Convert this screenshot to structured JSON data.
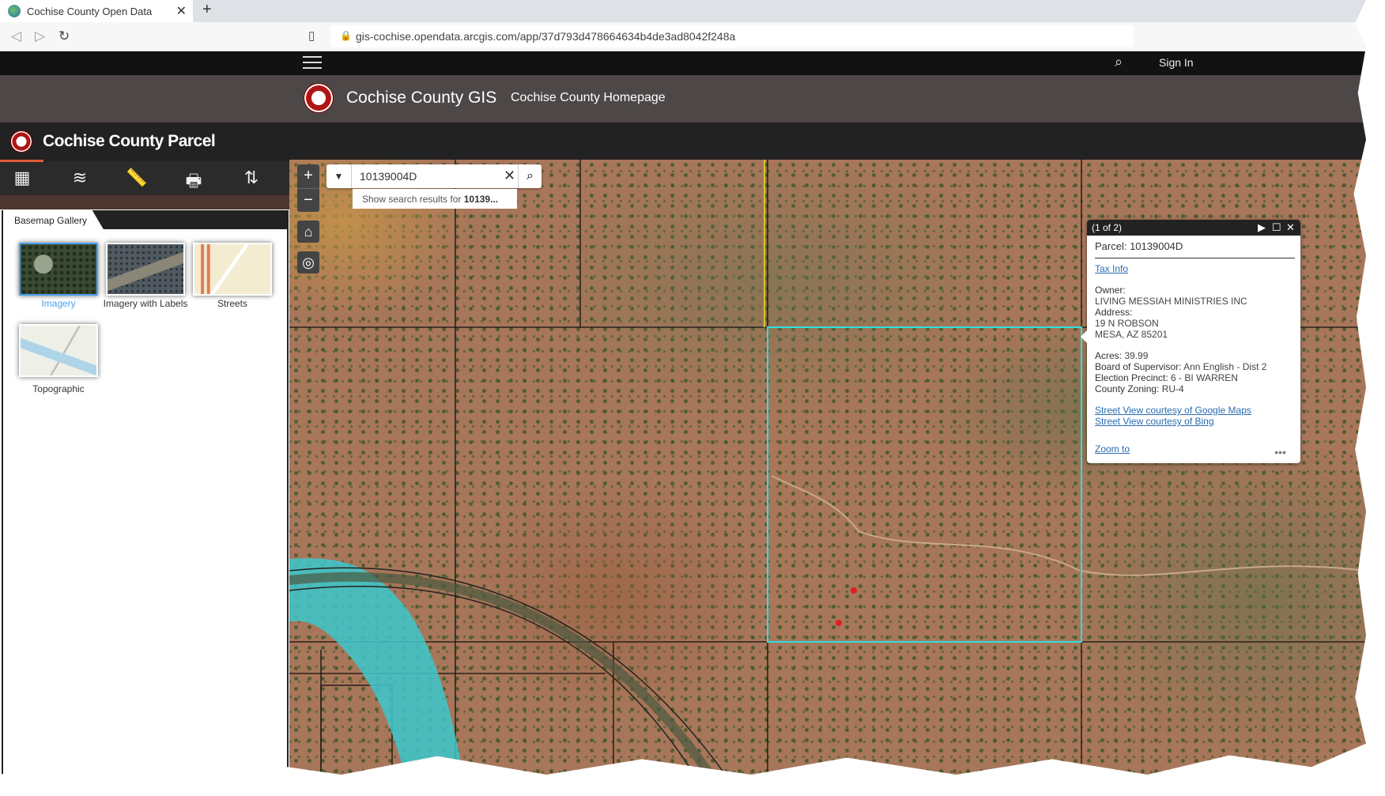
{
  "browser": {
    "tab_title": "Cochise County Open Data",
    "url": "gis-cochise.opendata.arcgis.com/app/37d793d478664634b4de3ad8042f248a"
  },
  "topbar": {
    "sign_in": "Sign In"
  },
  "header": {
    "title": "Cochise County GIS",
    "homepage_link": "Cochise County Homepage"
  },
  "app": {
    "title": "Cochise County Parcel"
  },
  "toolbar": {
    "icons": [
      "basemap-gallery-icon",
      "layers-icon",
      "measure-icon",
      "print-icon",
      "share-icon"
    ]
  },
  "panel": {
    "tab": "Basemap Gallery",
    "basemaps": [
      {
        "label": "Imagery",
        "selected": true
      },
      {
        "label": "Imagery with Labels",
        "selected": false
      },
      {
        "label": "Streets",
        "selected": false
      },
      {
        "label": "Topographic",
        "selected": false
      }
    ]
  },
  "search": {
    "value": "10139004D",
    "suggestion_prefix": "Show search results for ",
    "suggestion_term": "10139..."
  },
  "popup": {
    "counter": "(1 of 2)",
    "parcel": "Parcel: 10139004D",
    "tax_info": "Tax Info",
    "owner_label": "Owner:",
    "owner": "LIVING MESSIAH MINISTRIES INC",
    "address_label": "Address:",
    "address1": "19 N ROBSON",
    "address2": "MESA, AZ 85201",
    "acres_label": "Acres:",
    "acres": " 39.99",
    "supervisor_label": "Board of Supervisor:",
    "supervisor": " Ann English - Dist 2",
    "precinct_label": "Election Precinct:",
    "precinct": " 6 - BI WARREN",
    "zoning_label": "County Zoning:",
    "zoning": " RU-4",
    "google_link": "Street View courtesy of Google Maps",
    "bing_link": "Street View courtesy of Bing",
    "zoom_to": "Zoom to"
  },
  "colors": {
    "selection": "#2fe0e0",
    "accent": "#e05a3a",
    "selected_basemap": "#4aa3f0",
    "link": "#2a6cb0"
  }
}
